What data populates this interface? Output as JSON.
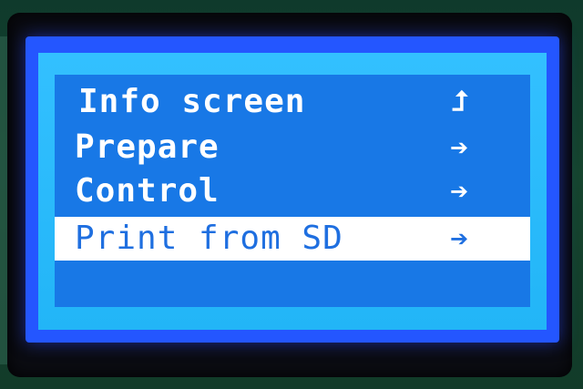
{
  "menu": {
    "items": [
      {
        "label": "Info screen",
        "arrow": "⮥",
        "icon": "back-up-arrow-icon",
        "selected": false
      },
      {
        "label": "Prepare",
        "arrow": "➔",
        "icon": "right-arrow-icon",
        "selected": false
      },
      {
        "label": "Control",
        "arrow": "➔",
        "icon": "right-arrow-icon",
        "selected": false
      },
      {
        "label": "Print from SD",
        "arrow": "➔",
        "icon": "right-arrow-icon",
        "selected": true
      }
    ]
  },
  "colors": {
    "lcd_background": "#1878e6",
    "lcd_text": "#ffffff",
    "selection_background": "#ffffff",
    "selection_text": "#1f6fe0",
    "bezel": "#0b0c12",
    "backlight": "#2456ff"
  }
}
